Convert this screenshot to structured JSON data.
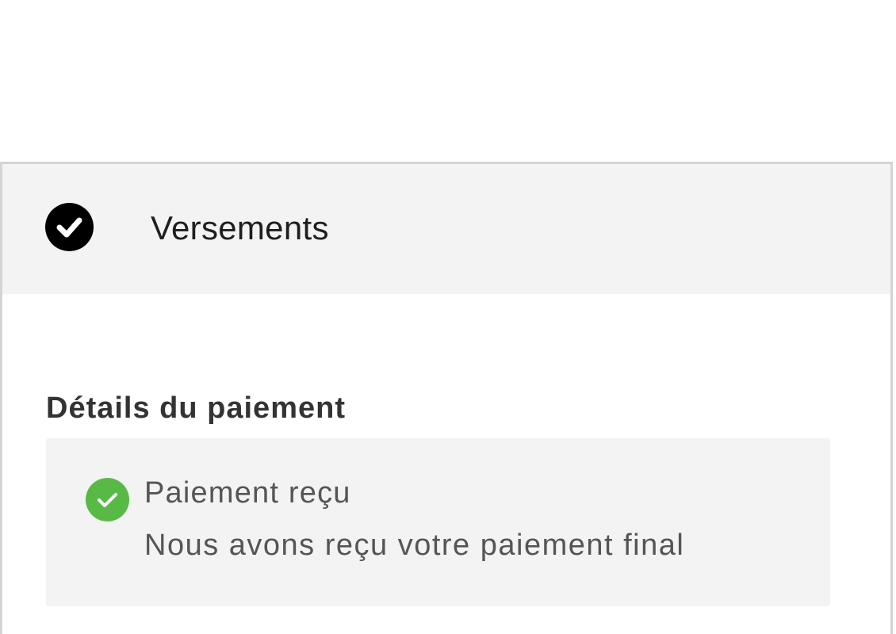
{
  "header": {
    "title": "Versements",
    "icon": "check-circle-icon",
    "icon_color": "#000000"
  },
  "payment_details": {
    "section_title": "Détails du paiement",
    "status": {
      "icon": "check-circle-icon",
      "icon_color": "#58b947",
      "title": "Paiement reçu",
      "description": "Nous avons reçu votre paiement final"
    }
  }
}
